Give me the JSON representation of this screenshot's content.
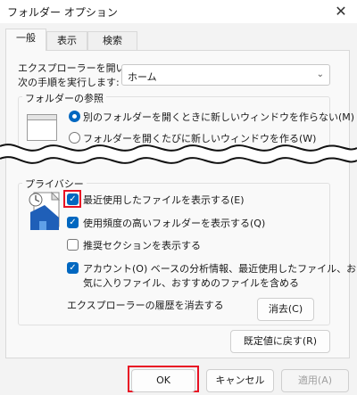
{
  "window": {
    "title": "フォルダー オプション",
    "close_icon": "close-icon"
  },
  "tabs": [
    {
      "label": "一般",
      "active": true
    },
    {
      "label": "表示",
      "active": false
    },
    {
      "label": "検索",
      "active": false
    }
  ],
  "open_explorer": {
    "label_line1": "エクスプローラーを開いて、",
    "label_line2": "次の手順を実行します:",
    "selected": "ホーム"
  },
  "browse_folders": {
    "legend": "フォルダーの参照",
    "options": [
      {
        "label": "別のフォルダーを開くときに新しいウィンドウを作らない(M)",
        "checked": true
      },
      {
        "label": "フォルダーを開くたびに新しいウィンドウを作る(W)",
        "checked": false
      }
    ]
  },
  "privacy": {
    "legend": "プライバシー",
    "options": [
      {
        "label": "最近使用したファイルを表示する(E)",
        "checked": true,
        "highlighted": true
      },
      {
        "label": "使用頻度の高いフォルダーを表示する(Q)",
        "checked": true
      },
      {
        "label": "推奨セクションを表示する",
        "checked": false
      },
      {
        "label_line1": "アカウント(O) ベースの分析情報、最近使用したファイル、お",
        "label_line2": "気に入りファイル、おすすめのファイルを含める",
        "checked": true
      }
    ],
    "clear_history_label": "エクスプローラーの履歴を消去する",
    "clear_button": "消去(C)"
  },
  "restore_defaults_button": "既定値に戻す(R)",
  "footer": {
    "ok": "OK",
    "cancel": "キャンセル",
    "apply": "適用(A)"
  },
  "colors": {
    "accent": "#0067c0",
    "highlight": "#e81123"
  }
}
